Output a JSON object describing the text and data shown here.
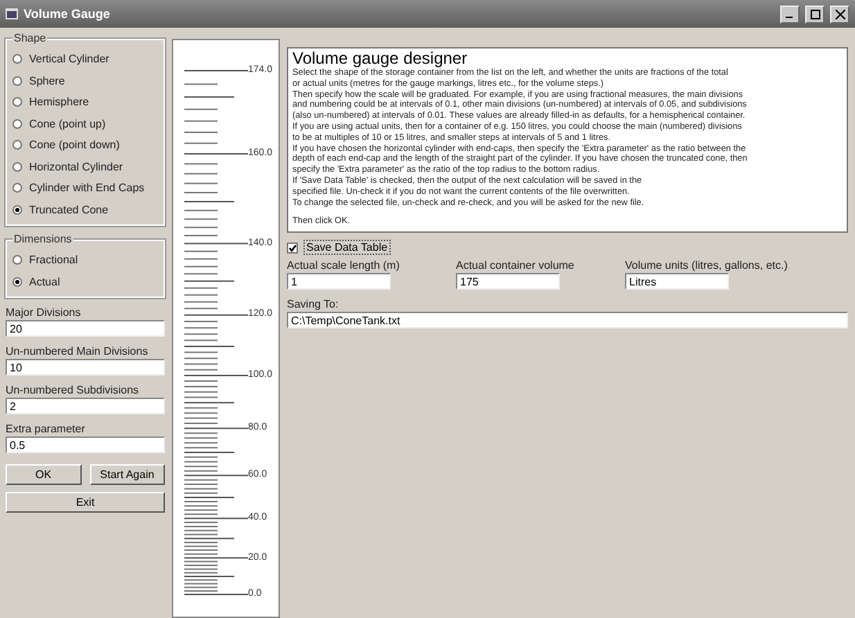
{
  "window": {
    "title": "Volume Gauge"
  },
  "shape": {
    "label": "Shape",
    "options": [
      {
        "label": "Vertical Cylinder",
        "selected": false
      },
      {
        "label": "Sphere",
        "selected": false
      },
      {
        "label": "Hemisphere",
        "selected": false
      },
      {
        "label": "Cone (point up)",
        "selected": false
      },
      {
        "label": "Cone (point down)",
        "selected": false
      },
      {
        "label": "Horizontal Cylinder",
        "selected": false
      },
      {
        "label": "Cylinder with End Caps",
        "selected": false
      },
      {
        "label": "Truncated Cone",
        "selected": true
      }
    ]
  },
  "dimensions": {
    "label": "Dimensions",
    "options": [
      {
        "label": "Fractional",
        "selected": false
      },
      {
        "label": "Actual",
        "selected": true
      }
    ]
  },
  "fields": [
    {
      "label": "Major Divisions",
      "value": "20"
    },
    {
      "label": "Un-numbered Main Divisions",
      "value": "10"
    },
    {
      "label": "Un-numbered Subdivisions",
      "value": "2"
    },
    {
      "label": "Extra parameter",
      "value": "0.5"
    }
  ],
  "buttons": [
    "OK",
    "Start Again",
    "Exit"
  ],
  "scale": {
    "labels": [
      "174.0",
      "160.0",
      "140.0",
      "120.0",
      "100.0",
      "80.0",
      "60.0",
      "40.0",
      "20.0",
      "0.0"
    ]
  },
  "description": {
    "title": "Volume gauge designer",
    "lines": [
      "Select the shape of the storage container from the list on the left, and whether the units are fractions of the total",
      "or actual units (metres for the gauge markings, litres etc., for the volume steps.)",
      "Then specify how the scale will be graduated. For example, if you are using fractional measures, the main divisions",
      "and numbering could be at intervals of 0.1, other main divisions (un-numbered) at intervals of 0.05, and subdivisions",
      "(also un-numbered) at intervals of 0.01. These values are already filled-in as defaults, for a hemispherical container.",
      "If you are using actual units, then for a container of e.g. 150 litres, you could choose the main (numbered) divisions",
      "to be at multiples of 10 or 15 litres, and smaller steps at intervals of 5 and 1 litres.",
      "If you have chosen the horizontal cylinder with end-caps, then specify the 'Extra parameter' as the ratio between the",
      "depth of each end-cap and the length of the straight part of the cylinder. If you have chosen the truncated cone, then",
      "specify the 'Extra parameter' as the ratio of the top radius to the bottom radius.",
      "If 'Save Data Table' is checked, then the output of the next calculation will be saved in the",
      "specified file. Un-check it if you do not want the current contents of the file overwritten.",
      "To change the selected file, un-check and re-check, and you will be asked for the new file."
    ],
    "closing": "Then click OK."
  },
  "save_table": {
    "label": "Save Data Table",
    "checked": true
  },
  "settings": [
    {
      "label": "Actual scale length (m)",
      "value": "1"
    },
    {
      "label": "Actual container volume",
      "value": "175"
    },
    {
      "label": "Volume units (litres, gallons, etc.)",
      "value": "Litres"
    }
  ],
  "saving_to": {
    "label": "Saving To:",
    "value": "C:\\Temp\\ConeTank.txt"
  }
}
